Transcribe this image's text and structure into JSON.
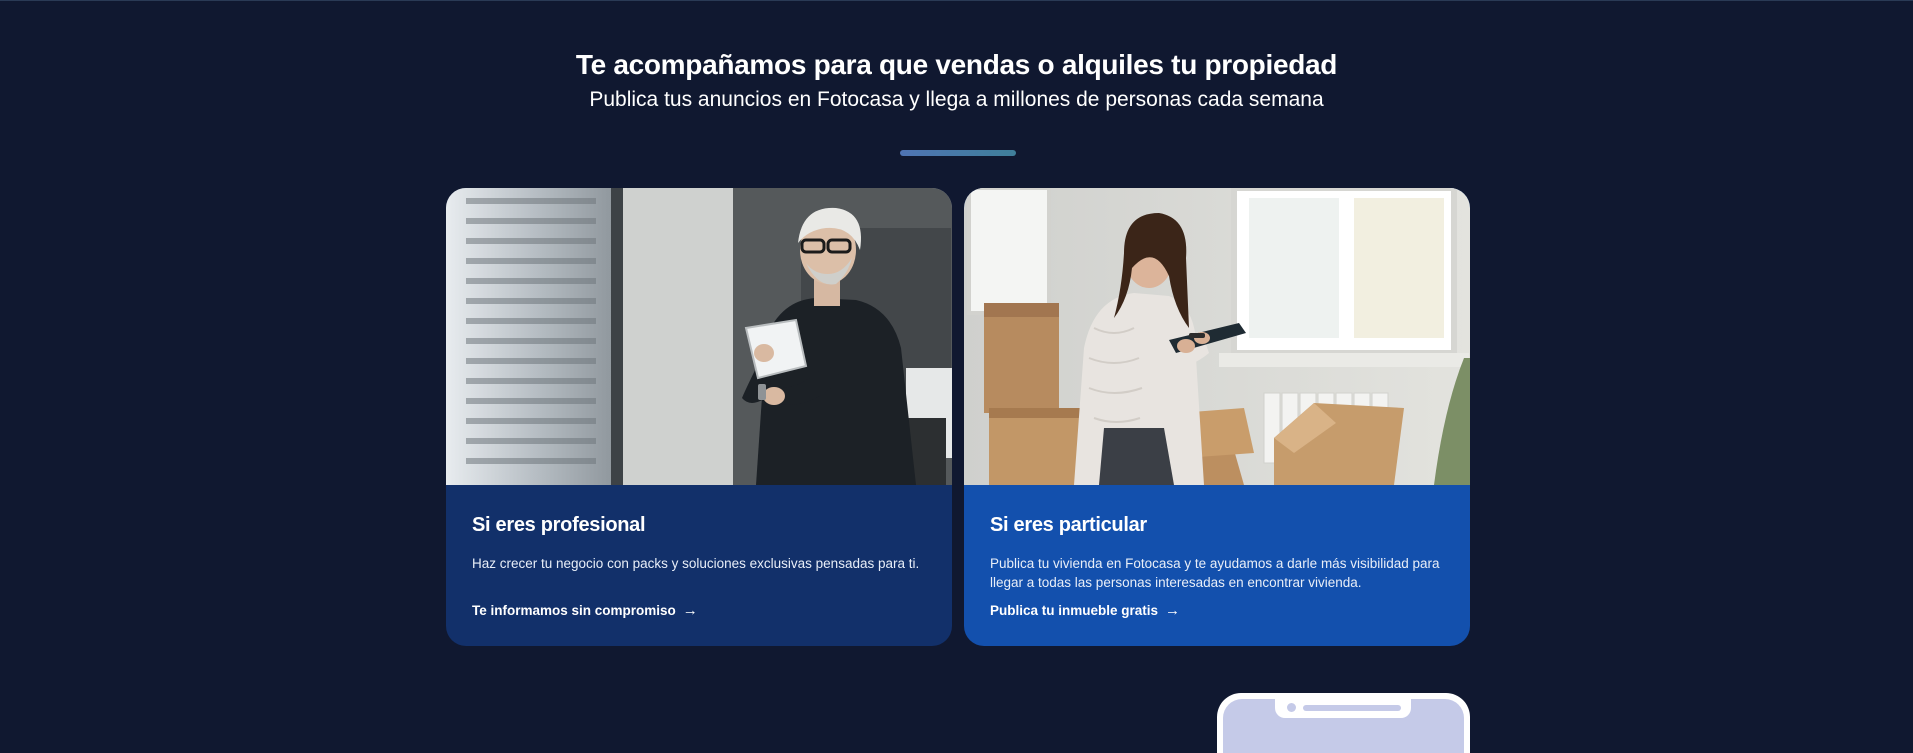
{
  "hero": {
    "title": "Te acompañamos para que vendas o alquiles tu propiedad",
    "subtitle": "Publica tus anuncios en Fotocasa y llega a millones de personas cada semana"
  },
  "cards": [
    {
      "title": "Si eres profesional",
      "description": "Haz crecer tu negocio con packs y soluciones exclusivas pensadas para ti.",
      "link": "Te informamos sin compromiso",
      "arrow": "→",
      "background": "#12306a",
      "image": "man-with-tablet-photo"
    },
    {
      "title": "Si eres particular",
      "description": "Publica tu vivienda en Fotocasa y te ayudamos a darle más visibilidad para llegar a todas las personas interesadas en encontrar vivienda.",
      "link": "Publica tu inmueble gratis",
      "arrow": "→",
      "background": "#1350ad",
      "image": "woman-with-clipboard-photo"
    }
  ],
  "colors": {
    "page_background": "#101830",
    "divider_start": "#4f74b4",
    "divider_end": "#3f7f9a",
    "phone_screen": "#c5cae8"
  }
}
